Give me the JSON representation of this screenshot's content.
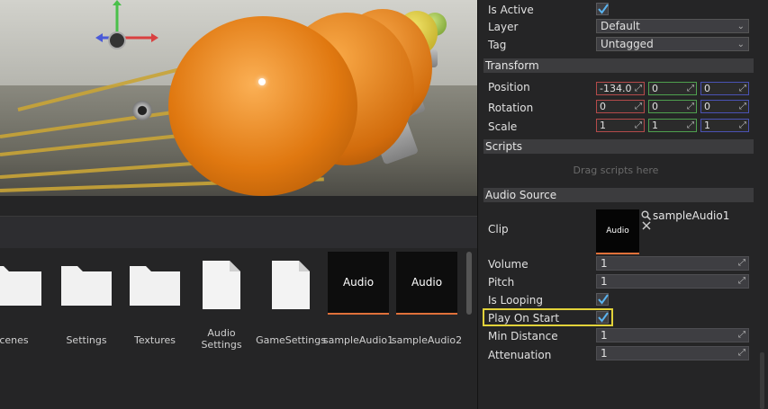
{
  "assets": {
    "items": [
      {
        "label": "Scenes",
        "type": "folder"
      },
      {
        "label": "Settings",
        "type": "folder"
      },
      {
        "label": "Textures",
        "type": "folder"
      },
      {
        "label": "Audio\nSettings",
        "type": "document"
      },
      {
        "label": "GameSettings",
        "type": "document"
      },
      {
        "label": "sampleAudio1",
        "type": "audio",
        "tile_text": "Audio"
      },
      {
        "label": "sampleAudio2",
        "type": "audio",
        "tile_text": "Audio"
      }
    ]
  },
  "inspector": {
    "is_active_label": "Is Active",
    "is_active": true,
    "layer_label": "Layer",
    "layer_value": "Default",
    "tag_label": "Tag",
    "tag_value": "Untagged",
    "transform": {
      "header": "Transform",
      "position_label": "Position",
      "position": [
        "-134.0",
        "0",
        "0"
      ],
      "rotation_label": "Rotation",
      "rotation": [
        "0",
        "0",
        "0"
      ],
      "scale_label": "Scale",
      "scale": [
        "1",
        "1",
        "1"
      ]
    },
    "scripts": {
      "header": "Scripts",
      "placeholder": "Drag scripts here"
    },
    "audio_source": {
      "header": "Audio Source",
      "clip_label": "Clip",
      "clip_tile_text": "Audio",
      "clip_name": "sampleAudio1",
      "volume_label": "Volume",
      "volume": "1",
      "pitch_label": "Pitch",
      "pitch": "1",
      "is_looping_label": "Is Looping",
      "is_looping": true,
      "play_on_start_label": "Play On Start",
      "play_on_start": true,
      "min_distance_label": "Min Distance",
      "min_distance": "1",
      "attenuation_label": "Attenuation",
      "attenuation": "1"
    }
  },
  "colors": {
    "accent_orange": "#e0713a",
    "highlight_yellow": "#e2d23a",
    "axis_x": "#d94040",
    "axis_y": "#4ac04a",
    "axis_z": "#4a5ad8"
  }
}
